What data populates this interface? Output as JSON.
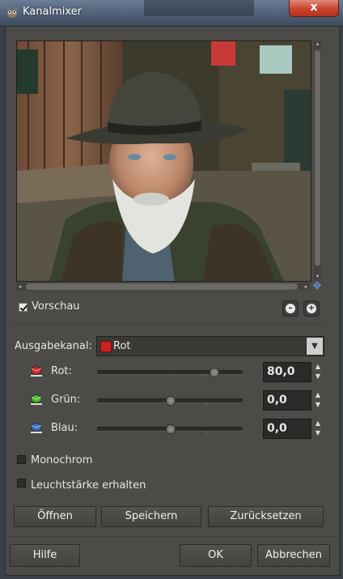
{
  "window": {
    "title": "Kanalmixer",
    "close_glyph": "x",
    "app_icon": "gimp-wilber-icon"
  },
  "preview": {
    "label": "Vorschau",
    "checked": true,
    "image_description_icon": "photo-preview",
    "zoom_out_icon": "zoom-out-icon",
    "zoom_in_icon": "zoom-in-icon"
  },
  "output": {
    "label": "Ausgabekanal:",
    "value": "Rot",
    "dropdown_glyph": "▼"
  },
  "channels": [
    {
      "key": "red",
      "label": "Rot:",
      "value": "80,0",
      "level": 0.8,
      "color": "#d42a2a"
    },
    {
      "key": "green",
      "label": "Grün:",
      "value": "0,0",
      "level": 0.5,
      "color": "#46b82a"
    },
    {
      "key": "blue",
      "label": "Blau:",
      "value": "0,0",
      "level": 0.5,
      "color": "#3b6fc4"
    }
  ],
  "options": {
    "monochrome": {
      "label": "Monochrom",
      "checked": false
    },
    "preserve_luminosity": {
      "label": "Leuchtstärke erhalten",
      "checked": false
    }
  },
  "buttons": {
    "open": "Öffnen",
    "save": "Speichern",
    "reset": "Zurücksetzen",
    "help": "Hilfe",
    "ok": "OK",
    "cancel": "Abbrechen"
  },
  "glyphs": {
    "spin_up": "▲",
    "spin_down": "▼",
    "scroll_left": "◂",
    "scroll_right": "▸",
    "scroll_up": "▴",
    "scroll_down": "▾",
    "navigate": "✥"
  },
  "colors": {
    "dialog_bg": "#4d4b47",
    "titlebar": "#4d5d73",
    "close_button": "#c8442e"
  }
}
